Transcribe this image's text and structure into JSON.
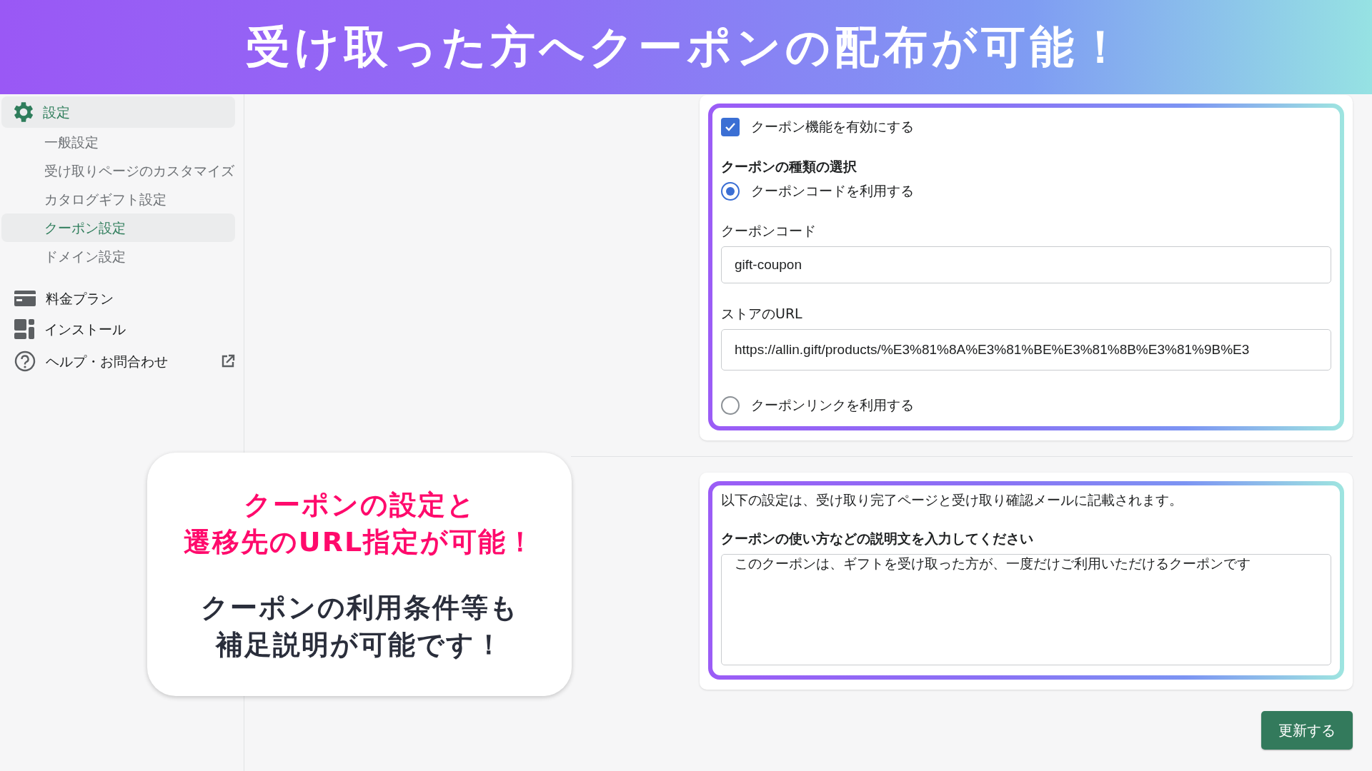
{
  "banner": {
    "title": "受け取った方へクーポンの配布が可能！"
  },
  "sidebar": {
    "items": [
      {
        "label": "設定",
        "kind": "settings",
        "selected": true,
        "children": [
          {
            "label": "一般設定",
            "selected": false
          },
          {
            "label": "受け取りページのカスタマイズ",
            "selected": false
          },
          {
            "label": "カタログギフト設定",
            "selected": false
          },
          {
            "label": "クーポン設定",
            "selected": true
          },
          {
            "label": "ドメイン設定",
            "selected": false
          }
        ]
      },
      {
        "label": "料金プラン",
        "kind": "plan",
        "selected": false
      },
      {
        "label": "インストール",
        "kind": "install",
        "selected": false
      },
      {
        "label": "ヘルプ・お問合わせ",
        "kind": "help",
        "selected": false,
        "external": true
      }
    ]
  },
  "coupon_card": {
    "enable_checkbox": {
      "label": "クーポン機能を有効にする",
      "checked": true
    },
    "type_title": "クーポンの種類の選択",
    "options": [
      {
        "label": "クーポンコードを利用する",
        "selected": true,
        "fields": [
          {
            "label": "クーポンコード",
            "value": "gift-coupon"
          },
          {
            "label": "ストアのURL",
            "value": "https://allin.gift/products/%E3%81%8A%E3%81%BE%E3%81%8B%E3%81%9B%E3"
          }
        ]
      },
      {
        "label": "クーポンリンクを利用する",
        "selected": false
      }
    ]
  },
  "description_card": {
    "note": "以下の設定は、受け取り完了ページと受け取り確認メールに記載されます。",
    "label": "クーポンの使い方などの説明文を入力してください",
    "value": "このクーポンは、ギフトを受け取った方が、一度だけご利用いただけるクーポンです"
  },
  "update_button": "更新する",
  "callout": {
    "paragraphs": [
      {
        "kind": "highlight",
        "lines": [
          "クーポンの設定と",
          "遷移先のURL指定が可能！"
        ]
      },
      {
        "kind": "body",
        "lines": [
          "クーポンの利用条件等も",
          "補足説明が可能です！"
        ]
      }
    ]
  }
}
